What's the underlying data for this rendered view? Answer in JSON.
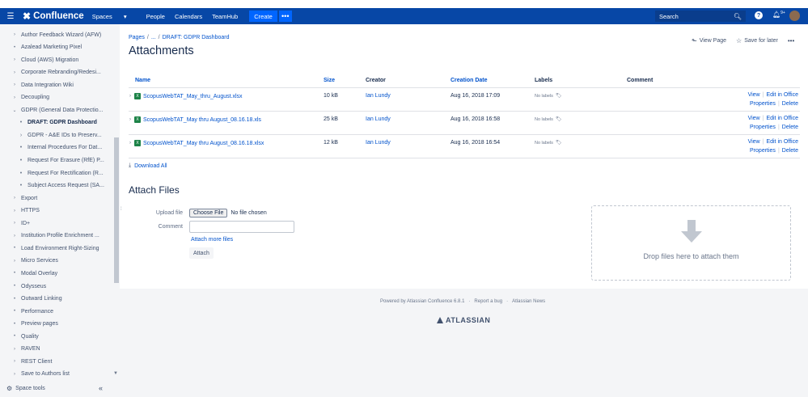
{
  "topbar": {
    "logo_text": "Confluence",
    "nav": [
      "Spaces",
      "People",
      "Calendars",
      "TeamHub"
    ],
    "spaces_label": "Spaces",
    "people_label": "People",
    "calendars_label": "Calendars",
    "teamhub_label": "TeamHub",
    "create_label": "Create",
    "more_label": "•••",
    "search_placeholder": "Search",
    "help_label": "?",
    "notifications_label": "9+",
    "brand_color": "#0747a6"
  },
  "sidebar": {
    "items": [
      {
        "label": "Author Feedback Wizard (AFW)",
        "kind": "chevron"
      },
      {
        "label": "Azalead Marketing Pixel",
        "kind": "bullet"
      },
      {
        "label": "Cloud (AWS) Migration",
        "kind": "chevron"
      },
      {
        "label": "Corporate Rebranding/Redesi...",
        "kind": "chevron"
      },
      {
        "label": "Data Integration Wiki",
        "kind": "chevron"
      },
      {
        "label": "Decoupling",
        "kind": "chevron"
      },
      {
        "label": "GDPR (General Data Protectio...",
        "kind": "expanded"
      },
      {
        "label": "DRAFT: GDPR Dashboard",
        "kind": "sub-active"
      },
      {
        "label": "GDPR - A&E IDs to Preserv...",
        "kind": "sub-chevron"
      },
      {
        "label": "Internal Procedures For Dat...",
        "kind": "sub"
      },
      {
        "label": "Request For Erasure (RfE) P...",
        "kind": "sub"
      },
      {
        "label": "Request For Rectification (R...",
        "kind": "sub"
      },
      {
        "label": "Subject Access Request (SA...",
        "kind": "sub"
      },
      {
        "label": "Export",
        "kind": "chevron"
      },
      {
        "label": "HTTPS",
        "kind": "chevron"
      },
      {
        "label": "ID+",
        "kind": "chevron"
      },
      {
        "label": "Institution Profile Enrichment ...",
        "kind": "chevron"
      },
      {
        "label": "Load Environment Right-Sizing",
        "kind": "bullet"
      },
      {
        "label": "Micro Services",
        "kind": "chevron"
      },
      {
        "label": "Modal Overlay",
        "kind": "bullet"
      },
      {
        "label": "Odysseus",
        "kind": "bullet"
      },
      {
        "label": "Outward Linking",
        "kind": "bullet"
      },
      {
        "label": "Performance",
        "kind": "bullet"
      },
      {
        "label": "Preview pages",
        "kind": "bullet"
      },
      {
        "label": "Quality",
        "kind": "bullet"
      },
      {
        "label": "RAVEN",
        "kind": "chevron"
      },
      {
        "label": "REST Client",
        "kind": "chevron"
      },
      {
        "label": "Save to Authors list",
        "kind": "chevron"
      }
    ],
    "space_tools_label": "Space tools",
    "collapse_label": "«"
  },
  "breadcrumb": {
    "root": "Pages",
    "ellipsis": "...",
    "sep": "/",
    "current": "DRAFT: GDPR Dashboard"
  },
  "page": {
    "title": "Attachments",
    "view_page_label": "View Page",
    "save_later_label": "Save for later",
    "more_label": "•••"
  },
  "table": {
    "headers": {
      "name": "Name",
      "size": "Size",
      "creator": "Creator",
      "date": "Creation Date",
      "labels": "Labels",
      "comment": "Comment"
    },
    "rows": [
      {
        "name": "ScopusWebTAT_May_thru_August.xlsx",
        "size": "10 kB",
        "creator": "Ian Lundy",
        "date": "Aug 16, 2018 17:09",
        "labels": "No labels"
      },
      {
        "name": "ScopusWebTAT_May thru August_08.16.18.xls",
        "size": "25 kB",
        "creator": "Ian Lundy",
        "date": "Aug 16, 2018 16:58",
        "labels": "No labels"
      },
      {
        "name": "ScopusWebTAT_May thru August_08.16.18.xlsx",
        "size": "12 kB",
        "creator": "Ian Lundy",
        "date": "Aug 16, 2018 16:54",
        "labels": "No labels"
      }
    ],
    "actions": {
      "view": "View",
      "edit_office": "Edit in Office",
      "properties": "Properties",
      "delete": "Delete"
    },
    "download_all_label": "Download All"
  },
  "attach": {
    "title": "Attach Files",
    "upload_label": "Upload file",
    "choose_file_label": "Choose File",
    "no_file_label": "No file chosen",
    "comment_label": "Comment",
    "attach_more_label": "Attach more files",
    "attach_button_label": "Attach",
    "drop_text": "Drop files here to attach them"
  },
  "footer": {
    "powered_by": "Powered by Atlassian Confluence 6.8.1",
    "report_bug": "Report a bug",
    "news": "Atlassian News",
    "brand": "ATLASSIAN"
  }
}
